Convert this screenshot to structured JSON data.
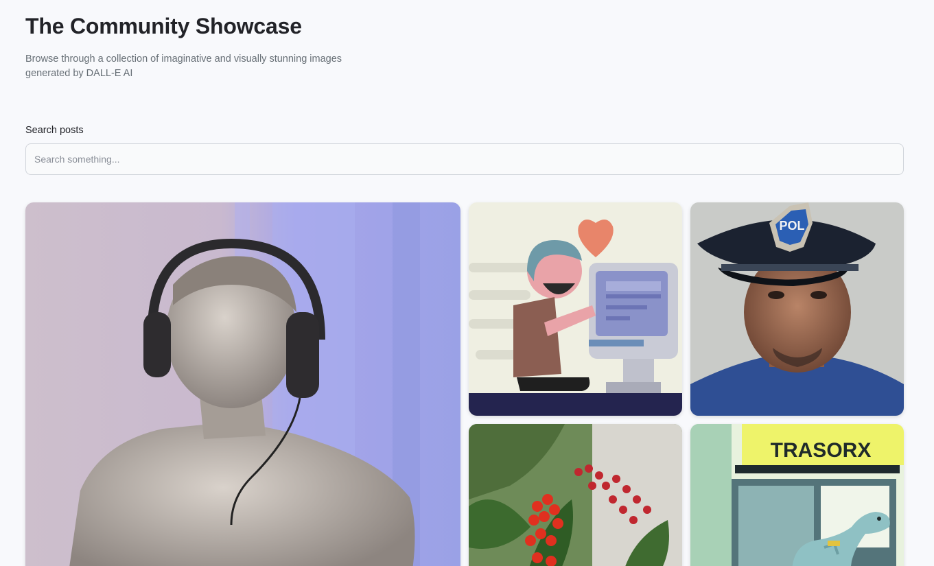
{
  "header": {
    "title": "The Community Showcase",
    "subtitle": "Browse through a collection of imaginative and visually stunning images generated by DALL-E AI"
  },
  "search": {
    "label": "Search posts",
    "placeholder": "Search something...",
    "value": ""
  },
  "gallery": {
    "cards": [
      {
        "subject": "marble statue wearing headphones"
      },
      {
        "subject": "cartoon person in love with computer"
      },
      {
        "subject": "police officer portrait",
        "badge_text": "POL"
      },
      {
        "subject": "red flowers"
      },
      {
        "subject": "dinosaur at kiosk",
        "sign_text": "TRASORX"
      }
    ]
  }
}
